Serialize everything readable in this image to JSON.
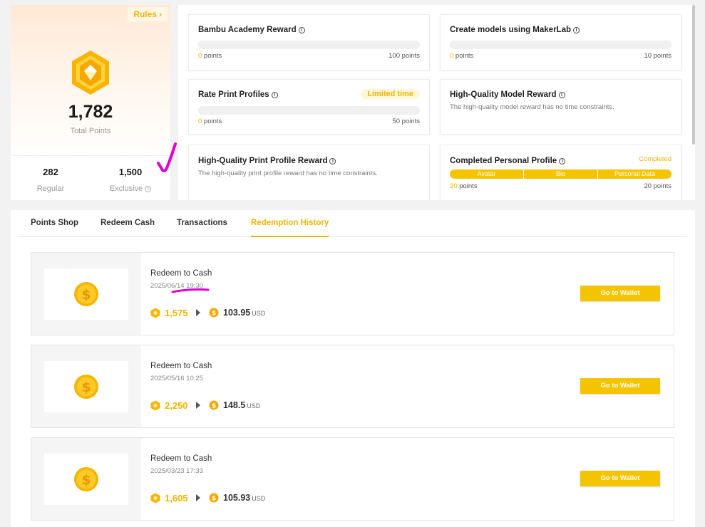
{
  "summary": {
    "rules_label": "Rules",
    "total_points": "1,782",
    "total_label": "Total Points",
    "regular_value": "282",
    "regular_label": "Regular",
    "exclusive_value": "1,500",
    "exclusive_label": "Exclusive"
  },
  "tasks": [
    {
      "title": "Bambu Academy Reward",
      "current": "0",
      "current_suffix": " points",
      "max": "100 points"
    },
    {
      "title": "Create models using MakerLab",
      "current": "0",
      "current_suffix": " points",
      "max": "10 points"
    },
    {
      "title": "Rate Print Profiles",
      "badge": "Limited time",
      "current": "0",
      "current_suffix": " points",
      "max": "50 points"
    },
    {
      "title": "High-Quality Model Reward",
      "description": "The high-quality model reward has no time constraints."
    },
    {
      "title": "High-Quality Print Profile Reward",
      "description": "The high-quality print profile reward has no time constraints."
    },
    {
      "title": "Completed Personal Profile",
      "status": "Completed",
      "segments": [
        "Avatar",
        "Bio",
        "Personal Data"
      ],
      "current": "20",
      "current_suffix": " points",
      "max": "20 points"
    }
  ],
  "tabs": [
    "Points Shop",
    "Redeem Cash",
    "Transactions",
    "Redemption History"
  ],
  "active_tab": "Redemption History",
  "records": [
    {
      "title": "Redeem to Cash",
      "date": "2025/06/14 19:30",
      "points": "1,575",
      "amount": "103.95",
      "currency": "USD",
      "button": "Go to Wallet"
    },
    {
      "title": "Redeem to Cash",
      "date": "2025/05/16 10:25",
      "points": "2,250",
      "amount": "148.5",
      "currency": "USD",
      "button": "Go to Wallet"
    },
    {
      "title": "Redeem to Cash",
      "date": "2025/03/23 17:33",
      "points": "1,605",
      "amount": "105.93",
      "currency": "USD",
      "button": "Go to Wallet"
    }
  ],
  "colors": {
    "accent": "#f5c400",
    "accent_text": "#f0b400",
    "annotation": "#e000d0"
  }
}
